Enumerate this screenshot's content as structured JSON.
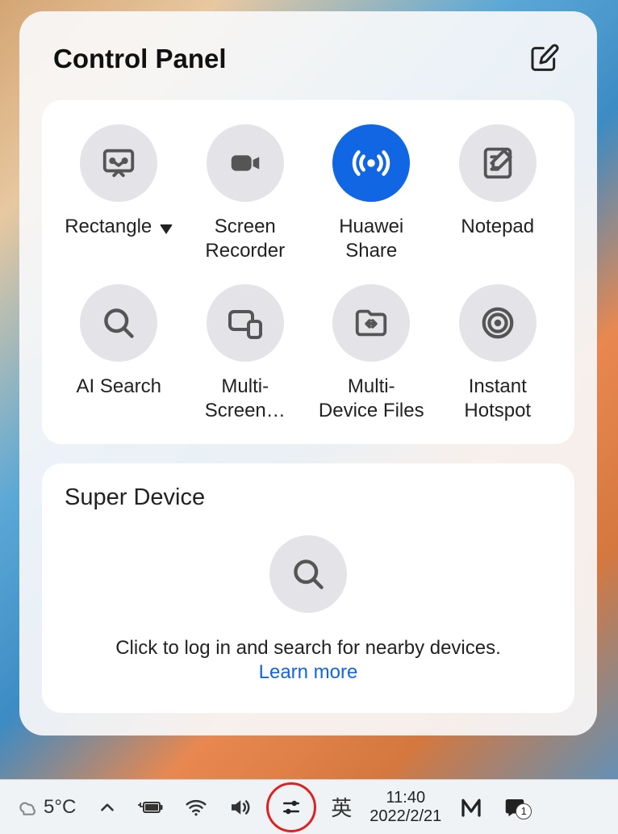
{
  "panel": {
    "title": "Control Panel",
    "tiles": [
      {
        "label": "Rectangle",
        "hasDropdown": true,
        "icon": "screenshot-icon",
        "active": false
      },
      {
        "label": "Screen\nRecorder",
        "hasDropdown": false,
        "icon": "screen-recorder-icon",
        "active": false
      },
      {
        "label": "Huawei\nShare",
        "hasDropdown": false,
        "icon": "huawei-share-icon",
        "active": true
      },
      {
        "label": "Notepad",
        "hasDropdown": false,
        "icon": "notepad-icon",
        "active": false
      },
      {
        "label": "AI Search",
        "hasDropdown": false,
        "icon": "search-icon",
        "active": false
      },
      {
        "label": "Multi-\nScreen…",
        "hasDropdown": false,
        "icon": "multi-screen-icon",
        "active": false
      },
      {
        "label": "Multi-\nDevice Files",
        "hasDropdown": false,
        "icon": "multi-device-files-icon",
        "active": false
      },
      {
        "label": "Instant\nHotspot",
        "hasDropdown": false,
        "icon": "hotspot-icon",
        "active": false
      }
    ]
  },
  "superDevice": {
    "title": "Super Device",
    "prompt": "Click to log in and search for nearby devices.",
    "link": "Learn more"
  },
  "taskbar": {
    "temperature": "5°C",
    "ime": "英",
    "time": "11:40",
    "date": "2022/2/21",
    "notifications": "1"
  }
}
